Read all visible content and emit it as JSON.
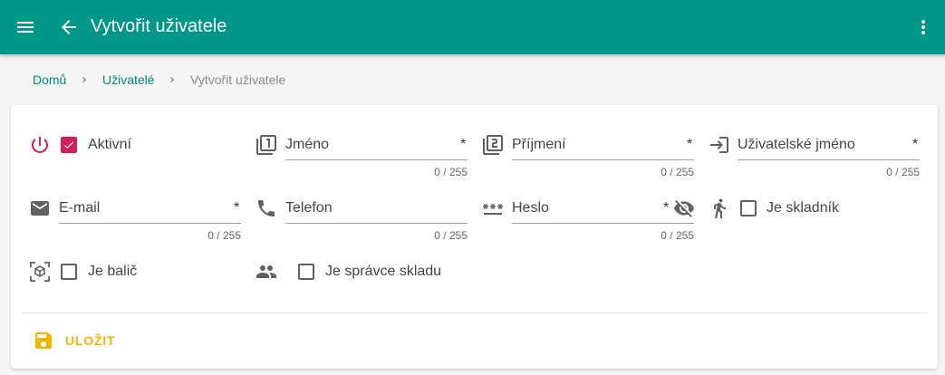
{
  "appbar": {
    "title": "Vytvořit uživatele",
    "menu_icon": "menu-icon",
    "back_icon": "arrow-back-icon",
    "more_icon": "more-vert-icon"
  },
  "breadcrumb": {
    "home": "Domů",
    "users": "Uživatelé",
    "current": "Vytvořit uživatele"
  },
  "form": {
    "active": {
      "label": "Aktivní",
      "checked": true
    },
    "first_name": {
      "label": "Jméno",
      "required": "*",
      "counter": "0 / 255"
    },
    "last_name": {
      "label": "Příjmení",
      "required": "*",
      "counter": "0 / 255"
    },
    "username": {
      "label": "Uživatelské jméno",
      "required": "*",
      "counter": "0 / 255"
    },
    "email": {
      "label": "E-mail",
      "required": "*",
      "counter": "0 / 255"
    },
    "phone": {
      "label": "Telefon",
      "counter": "0 / 255"
    },
    "password": {
      "label": "Heslo",
      "required": "*",
      "counter": "0 / 255"
    },
    "is_warehouseman": {
      "label": "Je skladník",
      "checked": false
    },
    "is_packer": {
      "label": "Je balič",
      "checked": false
    },
    "is_warehouse_admin": {
      "label": "Je správce skladu",
      "checked": false
    }
  },
  "actions": {
    "save_label": "ULOŽIT"
  },
  "colors": {
    "primary": "#009688",
    "accent": "#d81b60",
    "save": "#f4b400"
  }
}
